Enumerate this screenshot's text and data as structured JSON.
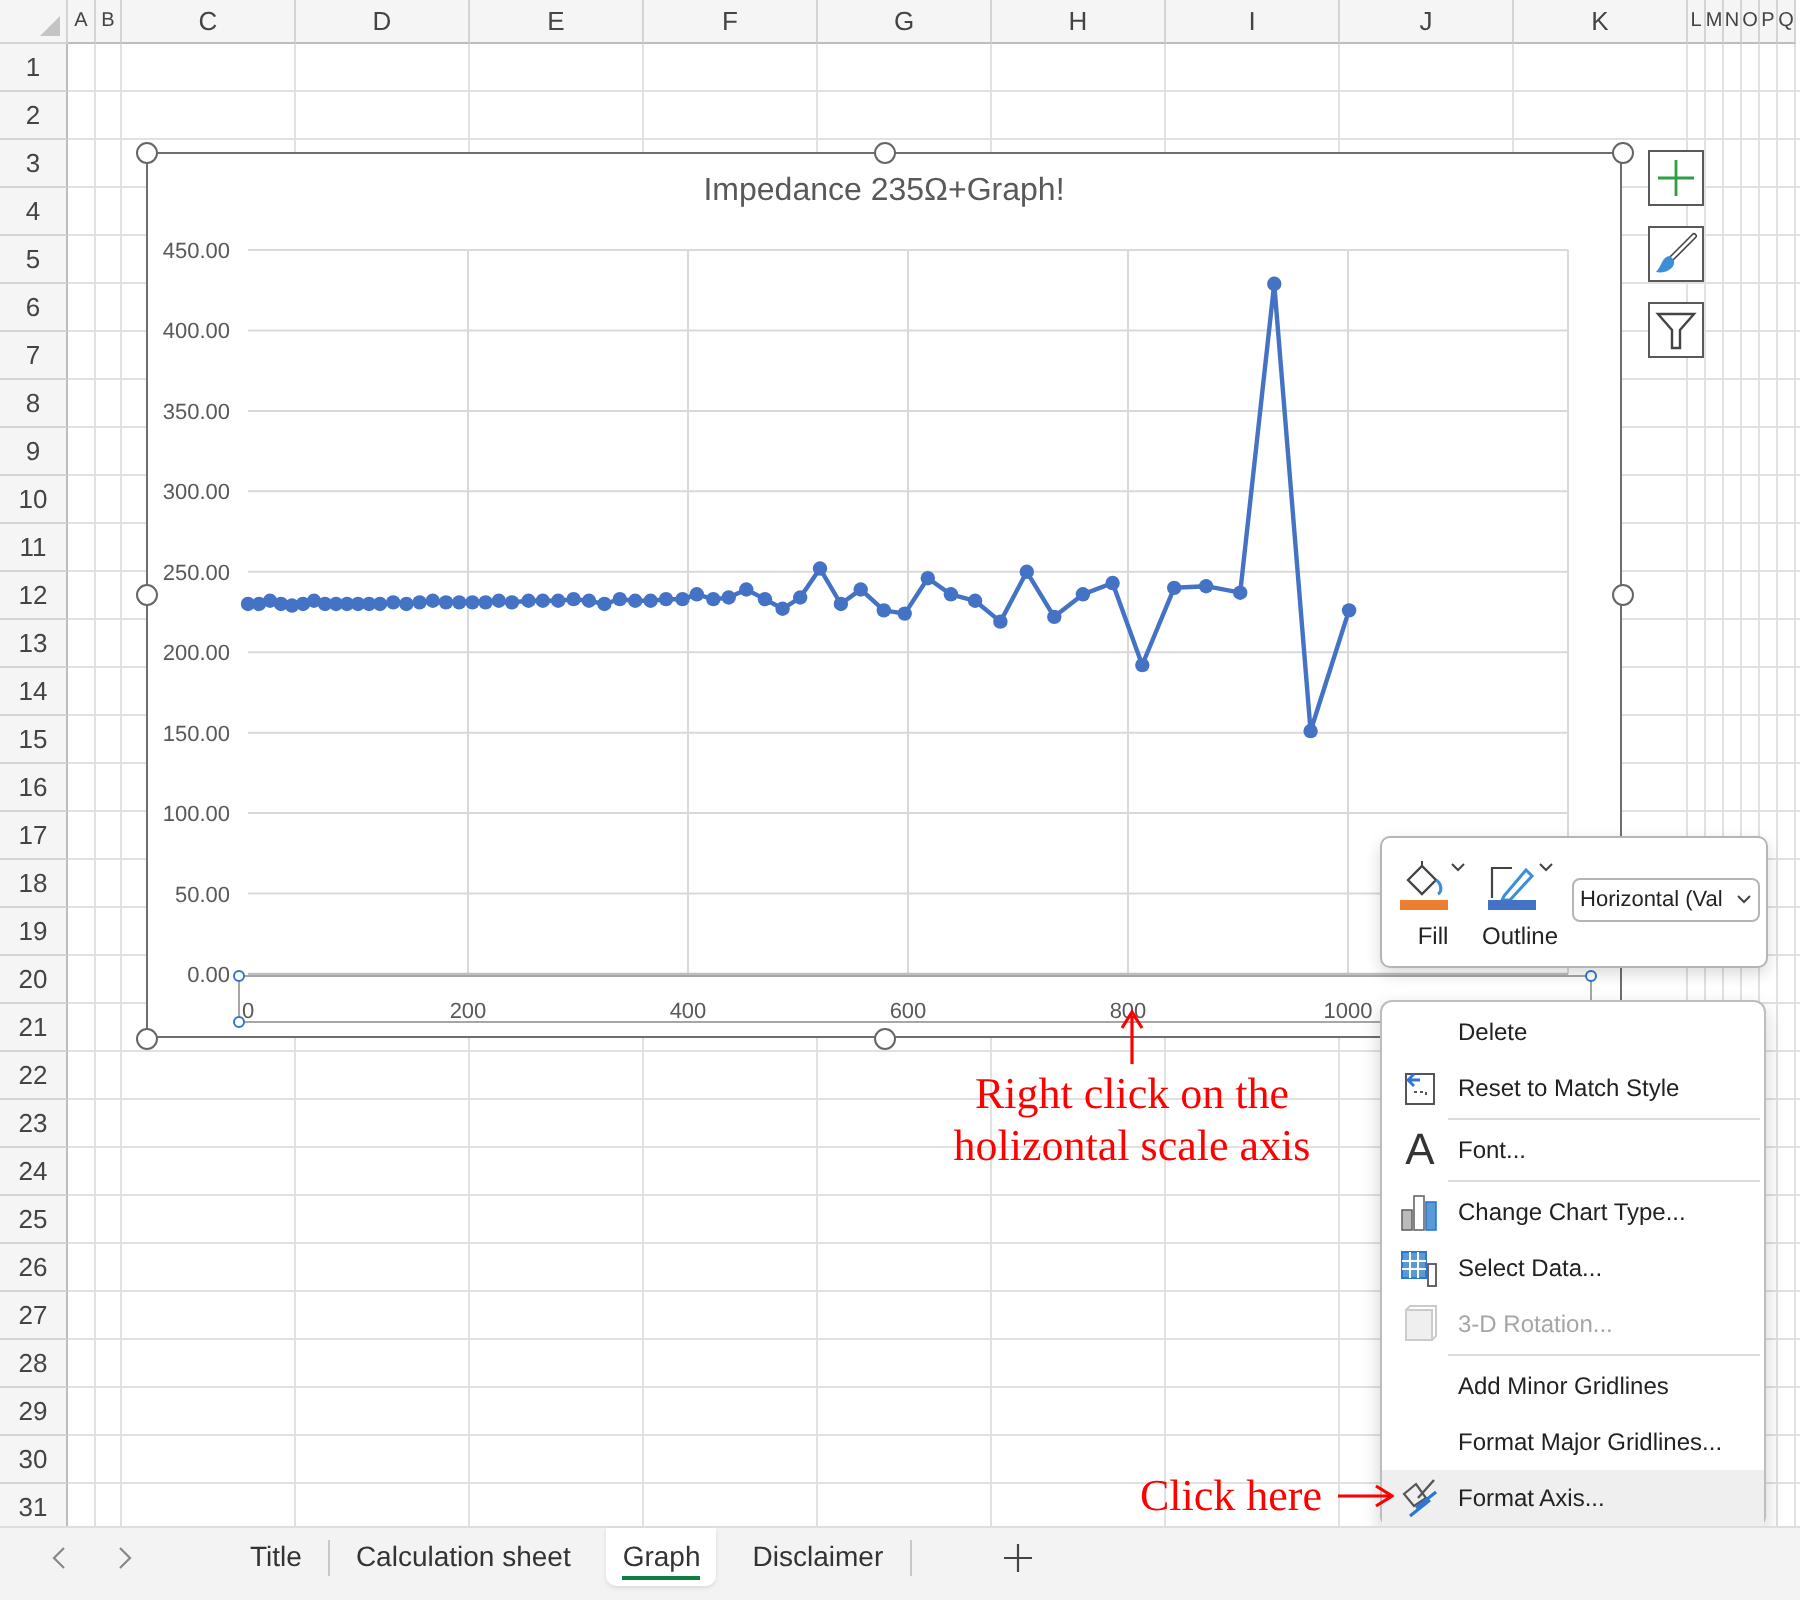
{
  "sheet": {
    "columns": [
      "A",
      "B",
      "C",
      "D",
      "E",
      "F",
      "G",
      "H",
      "I",
      "J",
      "K",
      "L",
      "M",
      "N",
      "O",
      "P",
      "Q"
    ],
    "rows": [
      "1",
      "2",
      "3",
      "4",
      "5",
      "6",
      "7",
      "8",
      "9",
      "10",
      "11",
      "12",
      "13",
      "14",
      "15",
      "16",
      "17",
      "18",
      "19",
      "20",
      "21",
      "22",
      "23",
      "24",
      "25",
      "26",
      "27",
      "28",
      "29",
      "30",
      "31"
    ]
  },
  "chart": {
    "title": "Impedance 235Ω+Graph!",
    "chart_data": {
      "type": "line",
      "grid": true,
      "x": [
        0,
        10,
        20,
        30,
        40,
        50,
        60,
        70,
        80,
        90,
        100,
        110,
        120,
        132,
        144,
        156,
        168,
        180,
        192,
        204,
        216,
        228,
        240,
        255,
        268,
        282,
        296,
        310,
        324,
        338,
        352,
        366,
        380,
        395,
        408,
        423,
        437,
        453,
        470,
        486,
        502,
        520,
        539,
        557,
        578,
        597,
        618,
        639,
        661,
        684,
        708,
        733,
        759,
        786,
        813,
        842,
        871,
        902,
        933,
        966,
        1001
      ],
      "series": [
        {
          "color": "#4472c4",
          "marker": true,
          "values": [
            230,
            230,
            232,
            230,
            229,
            230,
            232,
            230,
            230,
            230,
            230,
            230,
            230,
            231,
            230,
            231,
            232,
            231,
            231,
            231,
            231,
            232,
            231,
            232,
            232,
            232,
            233,
            232,
            230,
            233,
            232,
            232,
            233,
            233,
            236,
            233,
            234,
            239,
            233,
            227,
            234,
            252,
            230,
            239,
            226,
            224,
            246,
            236,
            232,
            219,
            250,
            222,
            236,
            243,
            192,
            240,
            241,
            237,
            429,
            151,
            226
          ]
        }
      ],
      "xlim": [
        0,
        1200
      ],
      "ylim": [
        0,
        450
      ],
      "xticks": [
        0,
        200,
        400,
        600,
        800,
        1000
      ],
      "yticks": [
        {
          "value": 0,
          "label": "0.00"
        },
        {
          "value": 50,
          "label": "50.00"
        },
        {
          "value": 100,
          "label": "100.00"
        },
        {
          "value": 150,
          "label": "150.00"
        },
        {
          "value": 200,
          "label": "200.00"
        },
        {
          "value": 250,
          "label": "250.00"
        },
        {
          "value": 300,
          "label": "300.00"
        },
        {
          "value": 350,
          "label": "350.00"
        },
        {
          "value": 400,
          "label": "400.00"
        },
        {
          "value": 450,
          "label": "450.00"
        }
      ]
    }
  },
  "mini_toolbar": {
    "buttons": [
      {
        "kind": "fill",
        "label": "Fill",
        "color": "#ed7d31"
      },
      {
        "kind": "outline",
        "label": "Outline",
        "color": "#4472c4"
      }
    ],
    "element_dropdown": {
      "value": "Horizontal (Val"
    }
  },
  "context_menu": {
    "items": [
      {
        "kind": "command",
        "label": "Delete",
        "disabled": false,
        "selected": false
      },
      {
        "kind": "command",
        "label": "Reset to Match Style",
        "disabled": false,
        "selected": false
      },
      {
        "kind": "separator"
      },
      {
        "kind": "command",
        "glyph": "A",
        "label": "Font...",
        "disabled": false,
        "selected": false
      },
      {
        "kind": "separator"
      },
      {
        "kind": "command",
        "label": "Change Chart Type...",
        "disabled": false,
        "selected": false
      },
      {
        "kind": "command",
        "label": "Select Data...",
        "disabled": false,
        "selected": false
      },
      {
        "kind": "command",
        "label": "3-D Rotation...",
        "disabled": true,
        "selected": false
      },
      {
        "kind": "separator"
      },
      {
        "kind": "command",
        "label": "Add Minor Gridlines",
        "disabled": false,
        "selected": false
      },
      {
        "kind": "command",
        "label": "Format Major Gridlines...",
        "disabled": false,
        "selected": false
      },
      {
        "kind": "command",
        "label": "Format Axis...",
        "disabled": false,
        "selected": true
      }
    ]
  },
  "annotations": [
    {
      "kind": "pointer_up",
      "text": "Right click on the holizontal scale axis"
    },
    {
      "kind": "pointer_right",
      "text": "Click here"
    }
  ],
  "sheet_tabs": [
    {
      "label": "Title",
      "selected": false
    },
    {
      "label": "Calculation sheet",
      "selected": false
    },
    {
      "label": "Graph",
      "selected": true
    },
    {
      "label": "Disclaimer",
      "selected": false
    }
  ]
}
